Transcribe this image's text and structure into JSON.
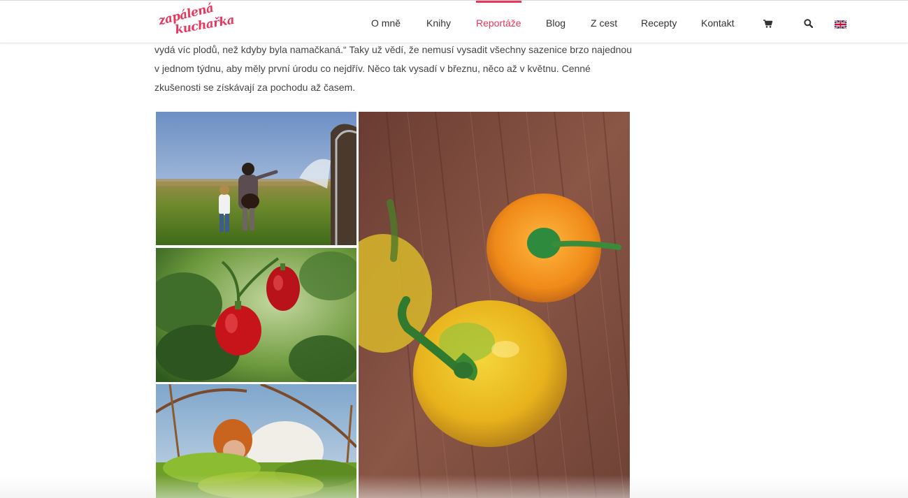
{
  "header": {
    "logo_line1": "zapálená",
    "logo_line2": "kuchařka",
    "nav": [
      "O mně",
      "Knihy",
      "Reportáže",
      "Blog",
      "Z cest",
      "Recepty",
      "Kontakt"
    ],
    "active_nav": "Reportáže",
    "icons": [
      "cart-icon",
      "search-icon",
      "uk-flag-icon"
    ]
  },
  "article": {
    "line1": "vydá víc plodů, než kdyby byla namačkaná.“ Taky už vědí, že nemusí vysadit všechny sazenice brzo najednou",
    "line2": "v jednom týdnu, aby měly první úrodu co nejdřív. Něco tak vysadí v březnu, něco až v květnu. Cenné",
    "line3": "zkušenosti se získávají za pochodu až časem."
  },
  "gallery": [
    "field-walk-photo",
    "red-peppers-photo",
    "greenhouse-photo",
    "yellow-peppers-photo"
  ],
  "colors": {
    "accent": "#e8365d",
    "text": "#444444",
    "nav_text": "#333333"
  }
}
